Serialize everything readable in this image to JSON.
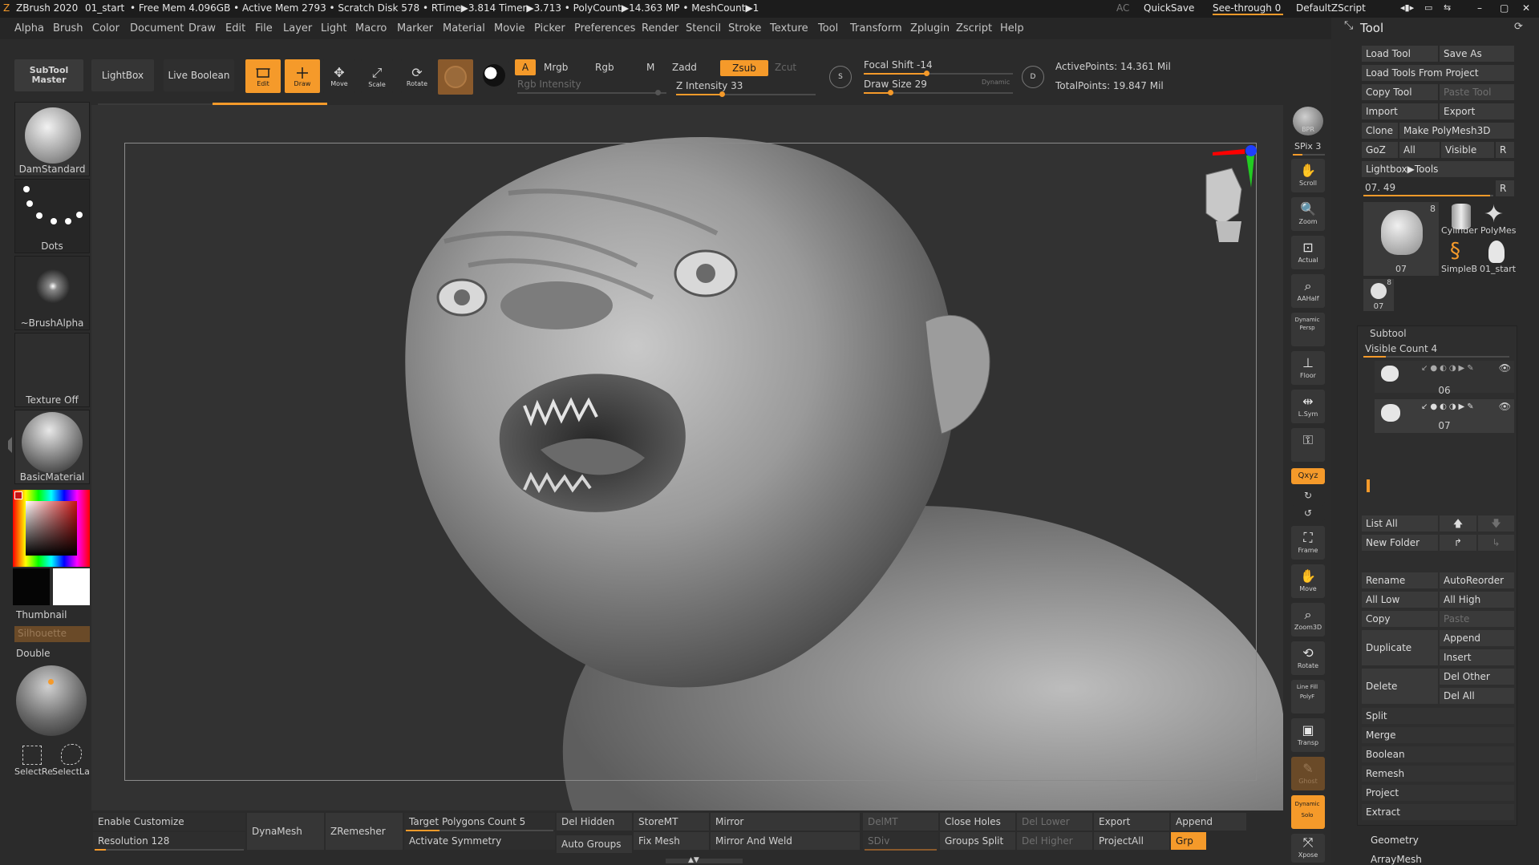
{
  "titlebar": {
    "app": "ZBrush 2020",
    "file": "01_start",
    "stats": "• Free Mem 4.096GB • Active Mem 2793 • Scratch Disk 578 • RTime▶3.814 Timer▶3.713 • PolyCount▶14.363 MP • MeshCount▶1",
    "ac": "AC",
    "quicksave": "QuickSave",
    "seethrough": "See-through  0",
    "script": "DefaultZScript"
  },
  "menu": [
    "Alpha",
    "Brush",
    "Color",
    "Document",
    "Draw",
    "Edit",
    "File",
    "Layer",
    "Light",
    "Macro",
    "Marker",
    "Material",
    "Movie",
    "Picker",
    "Preferences",
    "Render",
    "Stencil",
    "Stroke",
    "Texture",
    "Tool",
    "Transform",
    "Zplugin",
    "Zscript",
    "Help"
  ],
  "topshelf": {
    "subtool_master": "SubTool Master",
    "lightbox": "LightBox",
    "live_boolean": "Live Boolean",
    "edit": "Edit",
    "draw": "Draw",
    "move": "Move",
    "scale": "Scale",
    "rotate": "Rotate",
    "a": "A",
    "mrgb": "Mrgb",
    "rgb": "Rgb",
    "m": "M",
    "zadd": "Zadd",
    "zsub": "Zsub",
    "zcut": "Zcut",
    "rgb_intensity": "Rgb Intensity",
    "z_intensity": "Z Intensity 33",
    "z_intensity_value": 33,
    "focal_shift": "Focal Shift -14",
    "draw_size": "Draw Size 29",
    "dynamic": "Dynamic",
    "active_points": "ActivePoints: 14.361 Mil",
    "total_points": "TotalPoints: 19.847 Mil"
  },
  "leftshelf": {
    "brush": "DamStandard",
    "stroke": "Dots",
    "alpha": "~BrushAlpha",
    "texture": "Texture Off",
    "material": "BasicMaterial",
    "thumbnail": "Thumbnail",
    "silhouette": "Silhouette",
    "double": "Double",
    "select_rect": "SelectRe",
    "select_lasso": "SelectLa"
  },
  "rightstrip": {
    "bpr": "BPR",
    "spix": "SPix 3",
    "scroll": "Scroll",
    "zoom": "Zoom",
    "actual": "Actual",
    "aahalf": "AAHalf",
    "dynamic_persp": "Dynamic Persp",
    "floor": "Floor",
    "lsym": "L.Sym",
    "xyz": "Qxyz",
    "frame": "Frame",
    "move": "Move",
    "zoom3d": "Zoom3D",
    "rotate": "Rotate",
    "polyf": "Line Fill PolyF",
    "transp": "Transp",
    "ghost": "Ghost",
    "solo": "Dynamic Solo",
    "xpose": "Xpose"
  },
  "toolpanel": {
    "title": "Tool",
    "load_tool": "Load Tool",
    "save_as": "Save As",
    "load_from_project": "Load Tools From Project",
    "copy_tool": "Copy Tool",
    "paste_tool": "Paste Tool",
    "import": "Import",
    "export": "Export",
    "clone": "Clone",
    "make_polymesh": "Make PolyMesh3D",
    "goz": "GoZ",
    "all": "All",
    "visible": "Visible",
    "r": "R",
    "lightbox_tools": "Lightbox▶Tools",
    "current_tool": "07. 49",
    "thumb_main": "07",
    "thumb_main_count": "8",
    "thumb_cylinder": "Cylinder",
    "thumb_polymesh": "PolyMes",
    "thumb_simpleb": "SimpleB",
    "thumb_start": "01_start",
    "thumb_small": "07",
    "thumb_small_count": "8",
    "subtool": "Subtool",
    "visible_count": "Visible Count 4",
    "subtool_1": "06",
    "subtool_2": "07",
    "list_all": "List All",
    "new_folder": "New Folder",
    "rename": "Rename",
    "autoreorder": "AutoReorder",
    "all_low": "All Low",
    "all_high": "All High",
    "copy": "Copy",
    "paste": "Paste",
    "duplicate": "Duplicate",
    "append": "Append",
    "insert": "Insert",
    "delete": "Delete",
    "del_other": "Del Other",
    "del_all": "Del All",
    "split": "Split",
    "merge": "Merge",
    "boolean": "Boolean",
    "remesh": "Remesh",
    "project": "Project",
    "extract": "Extract",
    "geometry": "Geometry",
    "arraymesh": "ArrayMesh"
  },
  "bottom": {
    "enable_customize": "Enable Customize",
    "resolution": "Resolution 128",
    "dynamesh": "DynaMesh",
    "zremesher": "ZRemesher",
    "target_polygons": "Target Polygons Count 5",
    "activate_symmetry": "Activate Symmetry",
    "del_hidden": "Del Hidden",
    "auto_groups": "Auto Groups",
    "storemt": "StoreMT",
    "fix_mesh": "Fix Mesh",
    "mirror": "Mirror",
    "mirror_weld": "Mirror And Weld",
    "delmt": "DelMT",
    "sdiv": "SDiv",
    "close_holes": "Close Holes",
    "groups_split": "Groups Split",
    "del_lower": "Del Lower",
    "del_higher": "Del Higher",
    "export": "Export",
    "projectall": "ProjectAll",
    "append": "Append",
    "grp": "Grp"
  },
  "colors": {
    "accent": "#f59a2a",
    "bg": "#2b2b2b",
    "panel": "#3a3a3a"
  }
}
